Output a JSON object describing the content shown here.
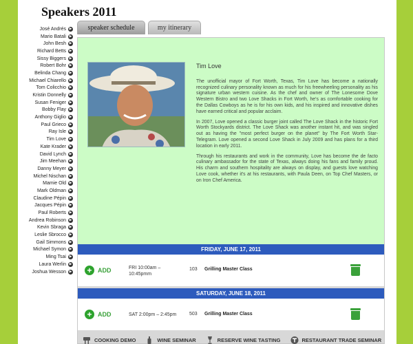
{
  "page": {
    "title": "Speakers 2011"
  },
  "speakers": [
    "José Andrés",
    "Mario Batali",
    "John Besh",
    "Richard Betts",
    "Sissy Biggers",
    "Robert Bohr",
    "Belinda Chang",
    "Michael Chiarello",
    "Tom Colicchio",
    "Kristin Donnelly",
    "Susan Feniger",
    "Bobby Flay",
    "Anthony Giglio",
    "Paul Grieco",
    "Ray Isle",
    "Tim Love",
    "Kate Krader",
    "David Lynch",
    "Jim Meehan",
    "Danny Meyer",
    "Michel Nischan",
    "Mamie Old",
    "Mark Oldman",
    "Claudine Pépin",
    "Jacques Pépin",
    "Paul Roberts",
    "Andrea Robinson",
    "Kevin Sbraga",
    "Leslie Sbrocco",
    "Gail Simmons",
    "Michael Symon",
    "Ming Tsai",
    "Laura Werlin",
    "Joshua Wesson"
  ],
  "tabs": [
    {
      "label": "speaker schedule"
    },
    {
      "label": "my itinerary"
    }
  ],
  "bio": {
    "name": "Tim Love",
    "paragraphs": [
      "The unofficial mayor of Fort Worth, Texas, Tim Love has become a nationally recognized culinary personality known as much for his freewheeling personality as his signature urban western cuisine. As the chef and owner of The Lonesome Dove Western Bistro and two Love Shacks in Fort Worth, he's as comfortable cooking for the Dallas Cowboys as he is for his own kids, and his inspired and innovative dishes have earned critical and popular acclaim.",
      "In 2007, Love opened a classic burger joint called The Love Shack in the historic Fort Worth Stockyards district. The Love Shack was another instant hit, and was singled out as having the \"most perfect burger on the planet\" by The Fort Worth Star-Telegram. Love opened a second Love Shack in July 2009 and has plans for a third location in early 2011.",
      "Through his restaurants and work in the community, Love has become the de facto culinary ambassador for the state of Texas, always doing his fans and family proud. His charm and southern hospitality are always on display, and guests love watching Love cook, whether it's at his restaurants, with Paula Deen, on Top Chef Masters, or on Iron Chef America."
    ]
  },
  "schedule": [
    {
      "day": "FRIDAY, JUNE 17, 2011",
      "add_label": "ADD",
      "time_line1": "FRI 10:00am –",
      "time_line2": "10:45pmm",
      "room": "103",
      "title": "Grilling Master Class"
    },
    {
      "day": "SATURDAY, JUNE 18, 2011",
      "add_label": "ADD",
      "time_line1": "SAT 2:00pm – 2:45pm",
      "time_line2": "",
      "room": "503",
      "title": "Grilling Master Class"
    }
  ],
  "legend": [
    {
      "label": "COOKING DEMO",
      "icon": "grill-icon"
    },
    {
      "label": "WINE SEMINAR",
      "icon": "bottle-icon"
    },
    {
      "label": "RESERVE WINE TASTING",
      "icon": "wine-glass-icon"
    },
    {
      "label": "RESTAURANT TRADE SEMINAR",
      "icon": "t-circle-icon"
    }
  ],
  "colors": {
    "background": "#a6cf3a",
    "bio_background": "#ccfcc6",
    "day_bar": "#2d5bbd",
    "add_green": "#3aa13a"
  }
}
